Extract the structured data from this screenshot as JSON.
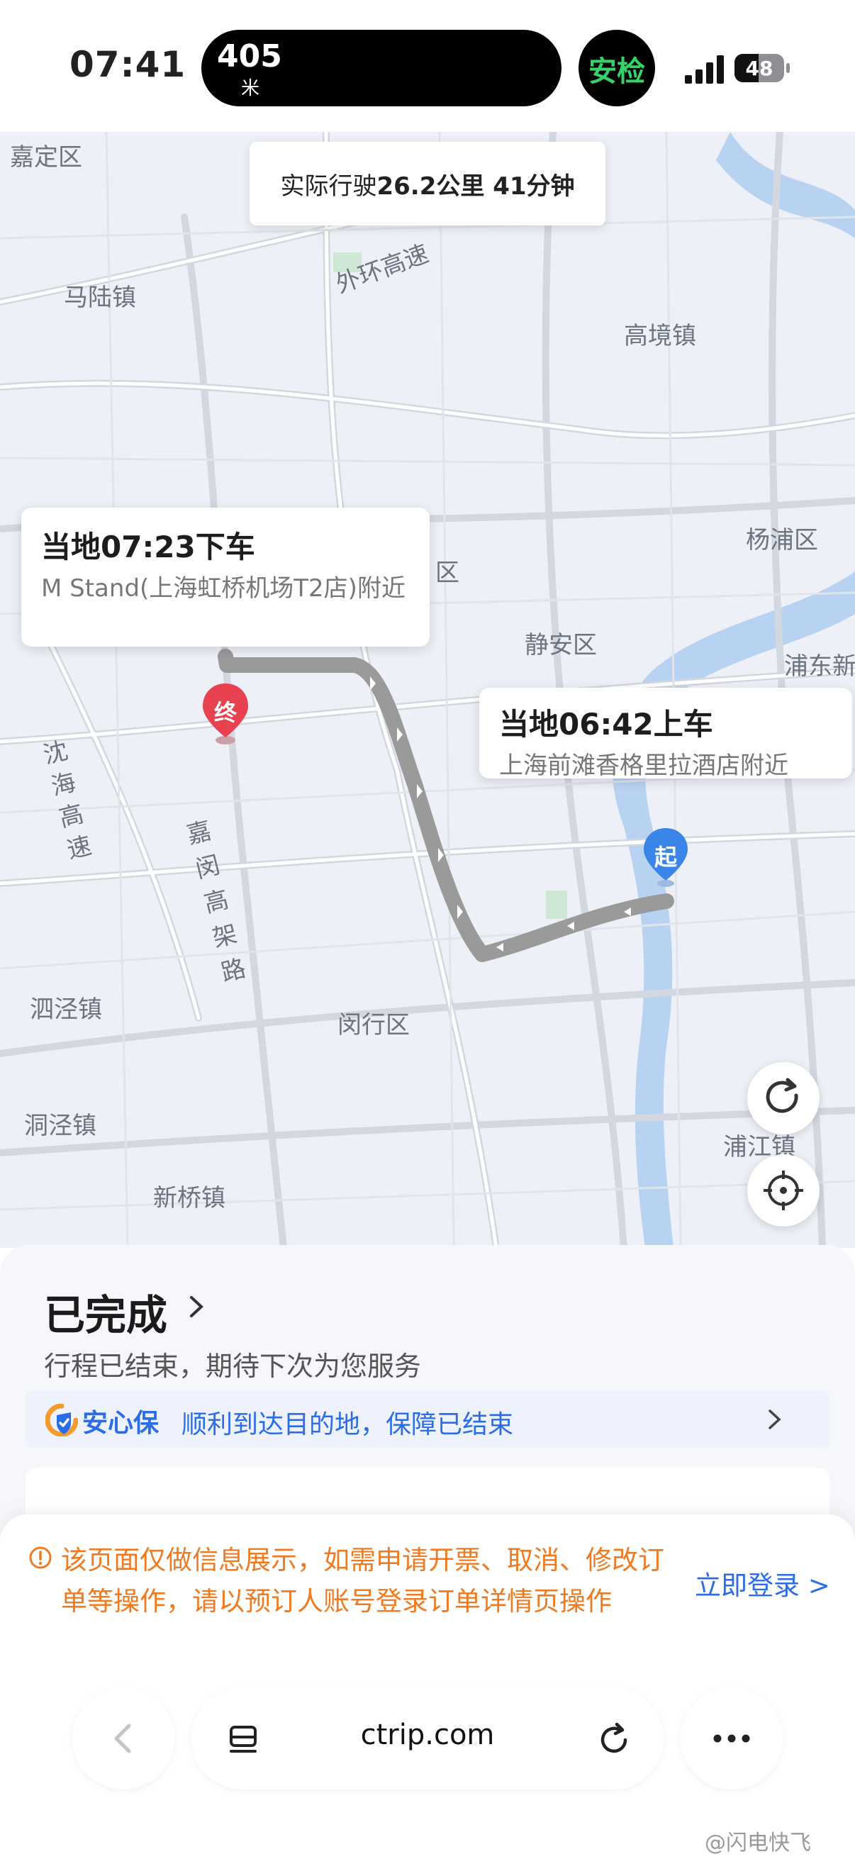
{
  "status_bar": {
    "time": "07:41",
    "island_distance": "405",
    "island_unit": "米",
    "safety_label": "安检",
    "battery": "48"
  },
  "map": {
    "trip_summary_prefix": "实际行驶",
    "trip_summary_value": "26.2公里 41分钟",
    "place_labels": [
      "嘉定区",
      "马陆镇",
      "外环高速",
      "高境镇",
      "杨浦区",
      "静安区",
      "浦东新",
      "沈海高速",
      "嘉闵高架路",
      "闵行区",
      "泗泾镇",
      "洞泾镇",
      "新桥镇",
      "浦江镇",
      "区"
    ],
    "dropoff": {
      "time_label": "当地07:23下车",
      "place": "M Stand(上海虹桥机场T2店)附近",
      "pin_label": "终",
      "pin_color": "#e8414f"
    },
    "pickup": {
      "time_label": "当地06:42上车",
      "place": "上海前滩香格里拉酒店附近",
      "pin_label": "起",
      "pin_color": "#3a86e8"
    },
    "refresh_icon": "refresh-icon",
    "locate_icon": "locate-icon"
  },
  "order": {
    "status": "已完成",
    "status_desc": "行程已结束，期待下次为您服务",
    "insurance_brand": "安心保",
    "insurance_text": "顺利到达目的地，保障已结束"
  },
  "notice": {
    "text": "该页面仅做信息展示，如需申请开票、取消、修改订单等操作，请以预订人账号登录订单详情页操作",
    "login_link": "立即登录 >",
    "color": "#f07a20"
  },
  "browser": {
    "url": "ctrip.com",
    "back_icon": "back-icon",
    "tabs_icon": "tabs-icon",
    "reload_icon": "reload-icon",
    "more_icon": "more-icon"
  },
  "watermark": "@闪电快飞"
}
